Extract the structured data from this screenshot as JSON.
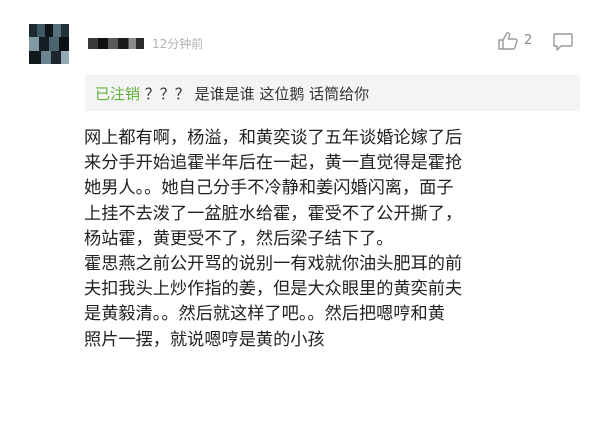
{
  "comment": {
    "time": "12分钟前",
    "like_count": "2",
    "quote": {
      "user": "已注销",
      "text": "？？？ 是谁是谁 这位鹅 话筒给你"
    },
    "body_lines": [
      "网上都有啊，杨溢，和黄奕谈了五年谈婚论嫁了后",
      "来分手开始追霍半年后在一起，黄一直觉得是霍抢",
      "她男人。。她自己分手不冷静和姜闪婚闪离，面子",
      "上挂不去泼了一盆脏水给霍，霍受不了公开撕了，",
      "杨站霍，黄更受不了，然后梁子结下了。",
      "霍思燕之前公开骂的说别一有戏就你油头肥耳的前",
      "夫扣我头上炒作指的姜，但是大众眼里的黄奕前夫",
      "是黄毅清。。然后就这样了吧。。然后把嗯哼和黄",
      "照片一摆，就说嗯哼是黄的小孩"
    ]
  },
  "icons": {
    "like": "thumbs-up-icon",
    "reply": "comment-bubble-icon"
  },
  "colors": {
    "quote_user": "#5fb43a",
    "meta_gray": "#b3b3b3",
    "quote_bg": "#f4f4f4"
  }
}
